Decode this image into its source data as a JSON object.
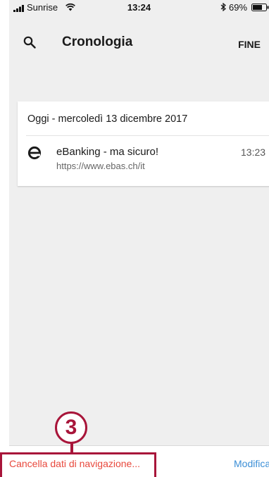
{
  "status_bar": {
    "carrier": "Sunrise",
    "time": "13:24",
    "battery": "69%"
  },
  "toolbar": {
    "title": "Cronologia",
    "done_label": "FINE",
    "search_icon": "search-icon"
  },
  "history": {
    "date_header": "Oggi - mercoledì 13 dicembre 2017",
    "entries": [
      {
        "title": "eBanking - ma sicuro!",
        "url": "https://www.ebas.ch/it",
        "time": "13:23",
        "icon": "ebanking-site-icon"
      }
    ]
  },
  "bottom_bar": {
    "clear_label": "Cancella dati di navigazione...",
    "edit_label": "Modifica"
  },
  "annotation": {
    "step": "3"
  },
  "colors": {
    "background": "#efefef",
    "clear_text": "#e8483c",
    "edit_text": "#3a8ed6",
    "annotation": "#a8153a"
  }
}
